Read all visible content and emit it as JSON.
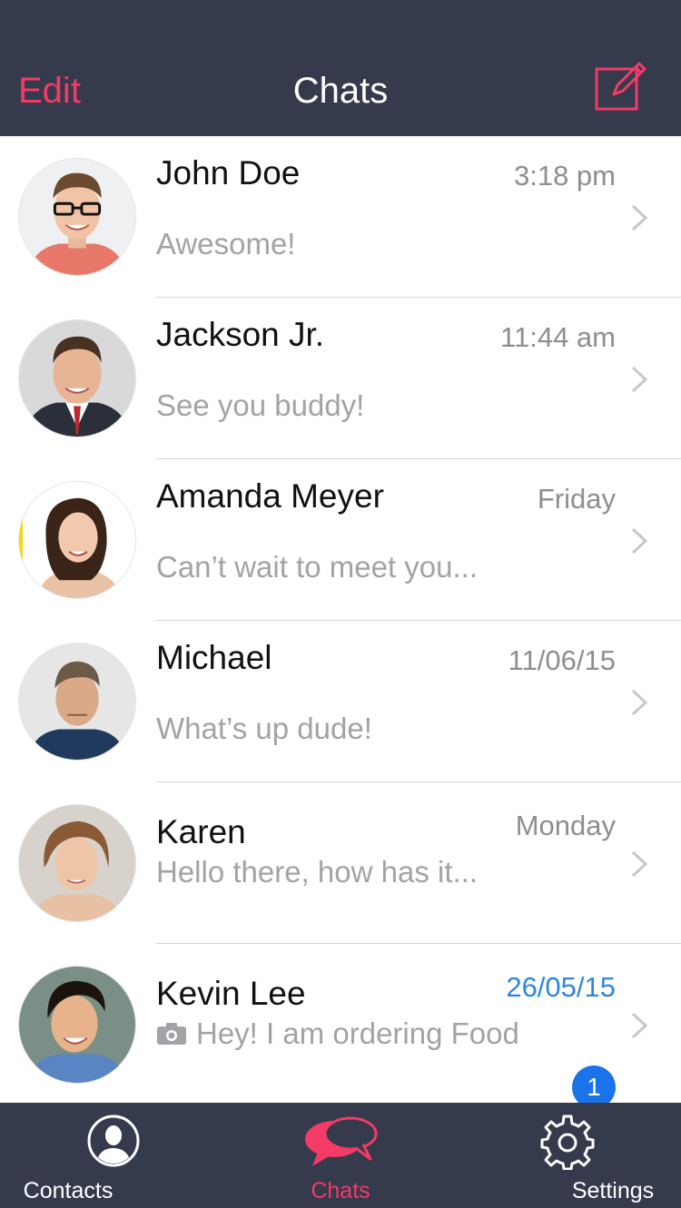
{
  "navbar": {
    "edit_label": "Edit",
    "title": "Chats",
    "compose_icon": "compose-icon"
  },
  "colors": {
    "accent": "#f23b66",
    "bar_background": "#363a4d",
    "unread_blue": "#2f86e0",
    "badge_blue": "#1a73e8"
  },
  "chats": [
    {
      "name": "John Doe",
      "time": "3:18 pm",
      "preview": "Awesome!",
      "unread": false
    },
    {
      "name": "Jackson Jr.",
      "time": "11:44 am",
      "preview": "See you buddy!",
      "unread": false
    },
    {
      "name": "Amanda Meyer",
      "time": "Friday",
      "preview": "Can’t wait to meet you...",
      "unread": false
    },
    {
      "name": "Michael",
      "time": "11/06/15",
      "preview": "What’s up dude!",
      "unread": false
    },
    {
      "name": "Karen",
      "time": "Monday",
      "preview": "Hello there, how has it...",
      "unread": false
    },
    {
      "name": "Kevin Lee",
      "time": "26/05/15",
      "preview": "Hey! I am ordering Food",
      "preview_icon": "camera-icon",
      "unread": true,
      "badge": "1"
    }
  ],
  "tabbar": {
    "tabs": [
      {
        "label": "Contacts",
        "icon": "contacts-icon",
        "active": false
      },
      {
        "label": "Chats",
        "icon": "chat-bubbles-icon",
        "active": true
      },
      {
        "label": "Settings",
        "icon": "gear-icon",
        "active": false
      }
    ]
  }
}
